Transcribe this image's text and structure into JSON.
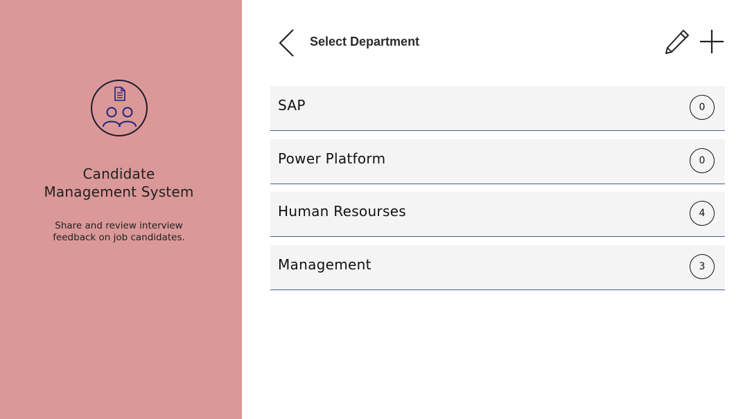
{
  "sidebar": {
    "logo_icon": "candidates-document-icon",
    "title_line1": "Candidate",
    "title_line2": "Management System",
    "subtitle_line1": "Share and review interview",
    "subtitle_line2": "feedback on job candidates.",
    "background": "#db9898"
  },
  "header": {
    "title": "Select Department",
    "back_icon": "chevron-left-icon",
    "edit_icon": "pencil-icon",
    "add_icon": "plus-icon"
  },
  "departments": [
    {
      "name": "SAP",
      "count": "0"
    },
    {
      "name": "Power Platform",
      "count": "0"
    },
    {
      "name": "Human Resourses",
      "count": "4"
    },
    {
      "name": "Management",
      "count": "3"
    }
  ],
  "colors": {
    "row_background": "#f4f4f4",
    "row_divider": "#4a5a8e",
    "logo_accent": "#1a237e"
  }
}
